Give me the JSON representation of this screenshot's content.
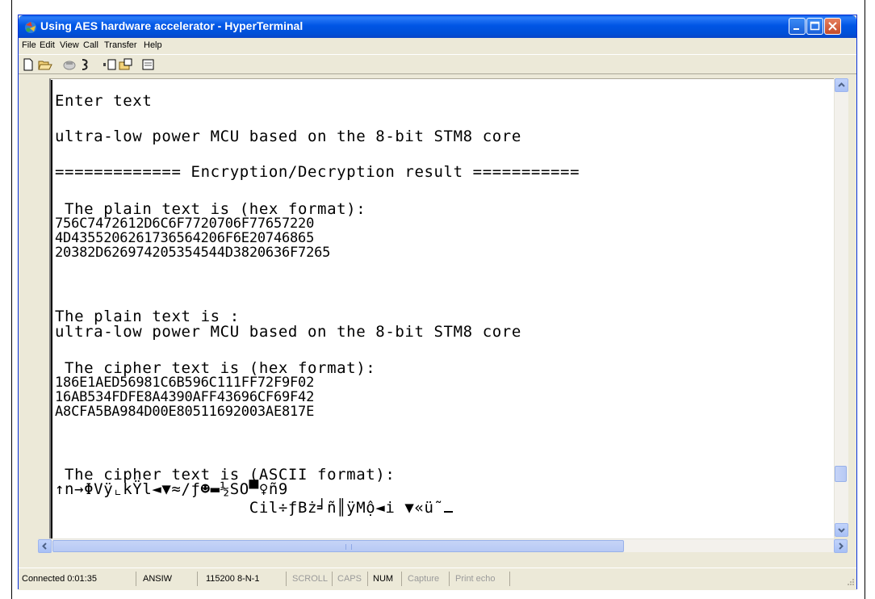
{
  "window": {
    "title": "Using AES hardware accelerator - HyperTerminal",
    "colors": {
      "titlebar": "#0055E5",
      "close": "#D4563A",
      "face": "#ECE9D8"
    }
  },
  "menu": [
    "File",
    "Edit",
    "View",
    "Call",
    "Transfer",
    "Help"
  ],
  "toolbar_icons": [
    "new-document-icon",
    "open-folder-icon",
    "phone-call-icon",
    "disconnect-icon",
    "send-icon",
    "receive-icon",
    "properties-icon"
  ],
  "terminal": {
    "lines": [
      "Enter text",
      "",
      "ultra-low power MCU based on the 8-bit STM8 core",
      "",
      "============= Encryption/Decryption result ===========",
      "",
      " The plain text is (hex format):",
      "756C7472612D6C6F7720706F77657220",
      "4D4355206261736564206F6E20746865",
      "20382D626974205354544D3820636F7265",
      "",
      "",
      "",
      "The plain text is :",
      "ultra-low power MCU based on the 8-bit STM8 core",
      "",
      " The cipher text is (hex format):",
      "186E1AED56981C6B596C111FF72F9F02",
      "16AB534FDFE8A4390AFF43696CF69F42",
      "A8CFA5BA984D00E80511692003AE817E",
      "",
      "",
      "",
      " The cipher text is (ASCII format):",
      "↑n→ΦVÿ⌞kŸl◄▼≈/ƒ☻▬½SO▀♀ñ9",
      "                    Cil÷ƒBż╛ñ║ÿMộ◄i ▼«ü˜"
    ]
  },
  "status": {
    "connected": "Connected 0:01:35",
    "emulation": "ANSIW",
    "settings": "115200 8-N-1",
    "scroll": "SCROLL",
    "caps": "CAPS",
    "num": "NUM",
    "capture": "Capture",
    "print_echo": "Print echo"
  }
}
